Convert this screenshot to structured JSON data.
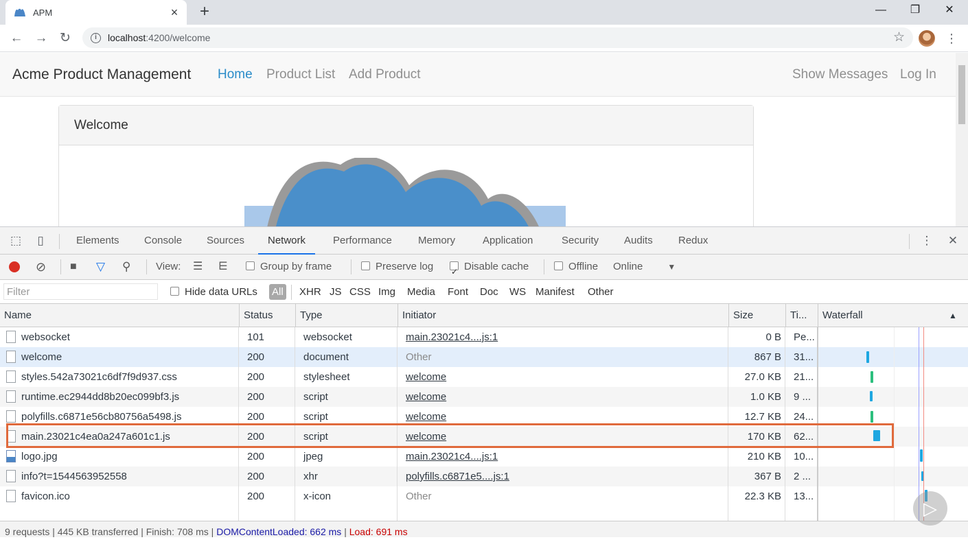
{
  "browser": {
    "tab_title": "APM",
    "new_tab_symbol": "+",
    "url_host": "localhost",
    "url_path": ":4200/welcome",
    "icons": {
      "back": "back-arrow-icon",
      "forward": "forward-arrow-icon",
      "reload": "reload-icon",
      "star": "star-icon",
      "menu": "kebab-menu-icon"
    }
  },
  "app": {
    "brand": "Acme Product Management",
    "nav": {
      "home": "Home",
      "product_list": "Product List",
      "add_product": "Add Product",
      "show_messages": "Show Messages",
      "log_in": "Log In"
    },
    "panel_title": "Welcome",
    "accent_color": "#2a8cc9"
  },
  "devtools": {
    "tabs": [
      "Elements",
      "Console",
      "Sources",
      "Network",
      "Performance",
      "Memory",
      "Application",
      "Security",
      "Audits",
      "Redux"
    ],
    "active_tab": "Network",
    "toolbar": {
      "view_label": "View:",
      "group_by_frame": "Group by frame",
      "preserve_log": "Preserve log",
      "disable_cache": "Disable cache",
      "disable_cache_checked": true,
      "offline": "Offline",
      "throttle": "Online"
    },
    "filter": {
      "placeholder": "Filter",
      "hide_data_urls": "Hide data URLs",
      "types": [
        "All",
        "XHR",
        "JS",
        "CSS",
        "Img",
        "Media",
        "Font",
        "Doc",
        "WS",
        "Manifest",
        "Other"
      ],
      "active_type": "All"
    },
    "columns": {
      "name": "Name",
      "status": "Status",
      "type": "Type",
      "initiator": "Initiator",
      "size": "Size",
      "time": "Ti...",
      "waterfall": "Waterfall",
      "sort_symbol": "▲"
    },
    "rows": [
      {
        "name": "websocket",
        "status": "101",
        "type": "websocket",
        "initiator": "main.23021c4....js:1",
        "initiator_link": true,
        "size": "0 B",
        "time": "Pe..."
      },
      {
        "name": "welcome",
        "status": "200",
        "type": "document",
        "initiator": "Other",
        "initiator_link": false,
        "size": "867 B",
        "time": "31..."
      },
      {
        "name": "styles.542a73021c6df7f9d937.css",
        "status": "200",
        "type": "stylesheet",
        "initiator": "welcome",
        "initiator_link": true,
        "size": "27.0 KB",
        "time": "21..."
      },
      {
        "name": "runtime.ec2944dd8b20ec099bf3.js",
        "status": "200",
        "type": "script",
        "initiator": "welcome",
        "initiator_link": true,
        "size": "1.0 KB",
        "time": "9 ..."
      },
      {
        "name": "polyfills.c6871e56cb80756a5498.js",
        "status": "200",
        "type": "script",
        "initiator": "welcome",
        "initiator_link": true,
        "size": "12.7 KB",
        "time": "24..."
      },
      {
        "name": "main.23021c4ea0a247a601c1.js",
        "status": "200",
        "type": "script",
        "initiator": "welcome",
        "initiator_link": true,
        "size": "170 KB",
        "time": "62..."
      },
      {
        "name": "logo.jpg",
        "status": "200",
        "type": "jpeg",
        "initiator": "main.23021c4....js:1",
        "initiator_link": true,
        "size": "210 KB",
        "time": "10..."
      },
      {
        "name": "info?t=1544563952558",
        "status": "200",
        "type": "xhr",
        "initiator": "polyfills.c6871e5....js:1",
        "initiator_link": true,
        "size": "367 B",
        "time": "2 ..."
      },
      {
        "name": "favicon.ico",
        "status": "200",
        "type": "x-icon",
        "initiator": "Other",
        "initiator_link": false,
        "size": "22.3 KB",
        "time": "13..."
      }
    ],
    "status_bar": {
      "requests": "9 requests",
      "transferred": "445 KB transferred",
      "finish": "Finish: 708 ms",
      "dom_content_loaded": "DOMContentLoaded: 662 ms",
      "load": "Load: 691 ms",
      "separator": "|"
    }
  }
}
